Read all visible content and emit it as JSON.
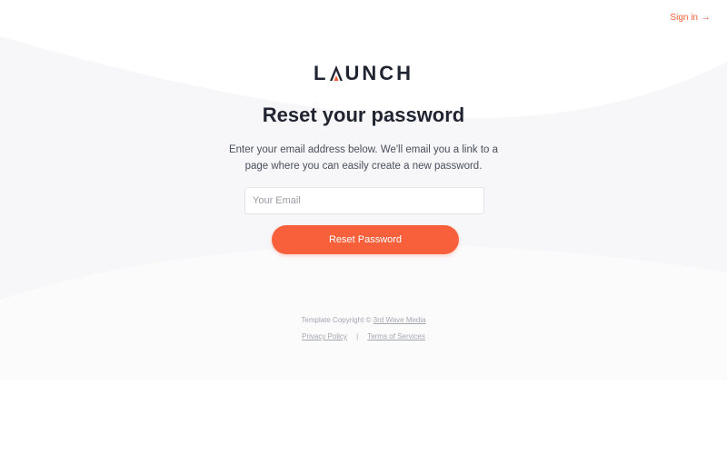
{
  "header": {
    "signin_label": "Sign in",
    "signin_arrow": "→"
  },
  "brand": {
    "logo_pre": "L",
    "logo_a": "A",
    "logo_post": "UNCH",
    "accent_color": "#f7603a"
  },
  "main": {
    "title": "Reset your password",
    "description": "Enter your email address below. We'll email you a link to a page where you can easily create a new password.",
    "email_placeholder": "Your Email",
    "email_value": "",
    "submit_label": "Reset Password"
  },
  "footer": {
    "copyright_prefix": "Template Copyright ©",
    "copyright_link": "3rd Wave Media",
    "privacy_label": "Privacy Policy",
    "separator": "|",
    "terms_label": "Terms of Services"
  }
}
